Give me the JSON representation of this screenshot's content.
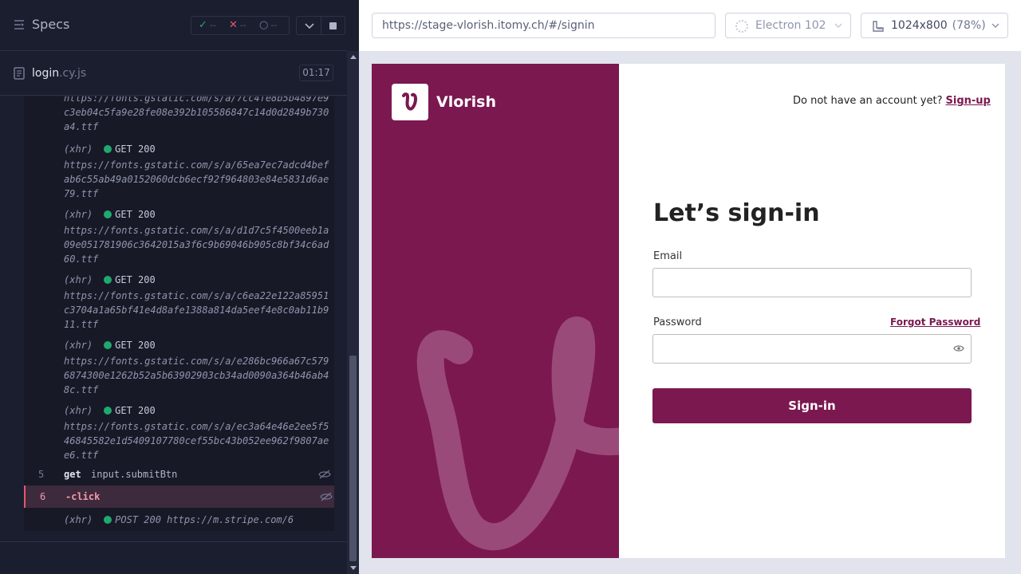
{
  "runner": {
    "title": "Specs",
    "stats": {
      "passed_icon": "check-icon",
      "passed": "--",
      "failed_icon": "x-icon",
      "failed": "--",
      "pending_icon": "spinner-icon",
      "pending": "--"
    },
    "spec_file": {
      "name": "login",
      "ext": ".cy.js",
      "duration": "01:17"
    },
    "logs": [
      {
        "url": "https://fonts.gstatic.com/s/a/7cc4fe8b5b4897e9c3eb04c5fa9e28fe08e392b105586847c14d0d2849b730a4.ttf"
      },
      {
        "type": "(xhr)",
        "status": "GET 200",
        "url": "https://fonts.gstatic.com/s/a/65ea7ec7adcd4befab6c55ab49a0152060dcb6ecf92f964803e84e5831d6ae79.ttf"
      },
      {
        "type": "(xhr)",
        "status": "GET 200",
        "url": "https://fonts.gstatic.com/s/a/d1d7c5f4500eeb1a09e051781906c3642015a3f6c9b69046b905c8bf34c6ad60.ttf"
      },
      {
        "type": "(xhr)",
        "status": "GET 200",
        "url": "https://fonts.gstatic.com/s/a/c6ea22e122a85951c3704a1a65bf41e4d8afe1388a814da5eef4e8c0ab11b911.ttf"
      },
      {
        "type": "(xhr)",
        "status": "GET 200",
        "url": "https://fonts.gstatic.com/s/a/e286bc966a67c5796874300e1262b52a5b63902903cb34ad0090a364b46ab48c.ttf"
      },
      {
        "type": "(xhr)",
        "status": "GET 200",
        "url": "https://fonts.gstatic.com/s/a/ec3a64e46e2ee5f546845582e1d5409107780cef55bc43b052ee962f9807aee6.ttf"
      }
    ],
    "commands": [
      {
        "num": "5",
        "name": "get",
        "arg": "input.submitBtn"
      },
      {
        "num": "6",
        "name": "-click",
        "arg": ""
      }
    ],
    "last_log": {
      "type": "(xhr)",
      "status": "POST 200",
      "url": "https://m.stripe.com/6"
    }
  },
  "aut": {
    "url": "https://stage-vlorish.itomy.ch/#/signin",
    "browser": "Electron 102",
    "browser_icon": "electron-icon",
    "viewport": "1024x800",
    "zoom": "(78%)"
  },
  "app": {
    "brand": "Vlorish",
    "brand_color": "#7b1850",
    "signup_prompt": "Do not have an account yet?",
    "signup_link": "Sign-up",
    "title": "Let’s sign-in",
    "email_label": "Email",
    "email_value": "",
    "password_label": "Password",
    "password_value": "",
    "forgot_link": "Forgot Password",
    "submit_label": "Sign-in"
  }
}
